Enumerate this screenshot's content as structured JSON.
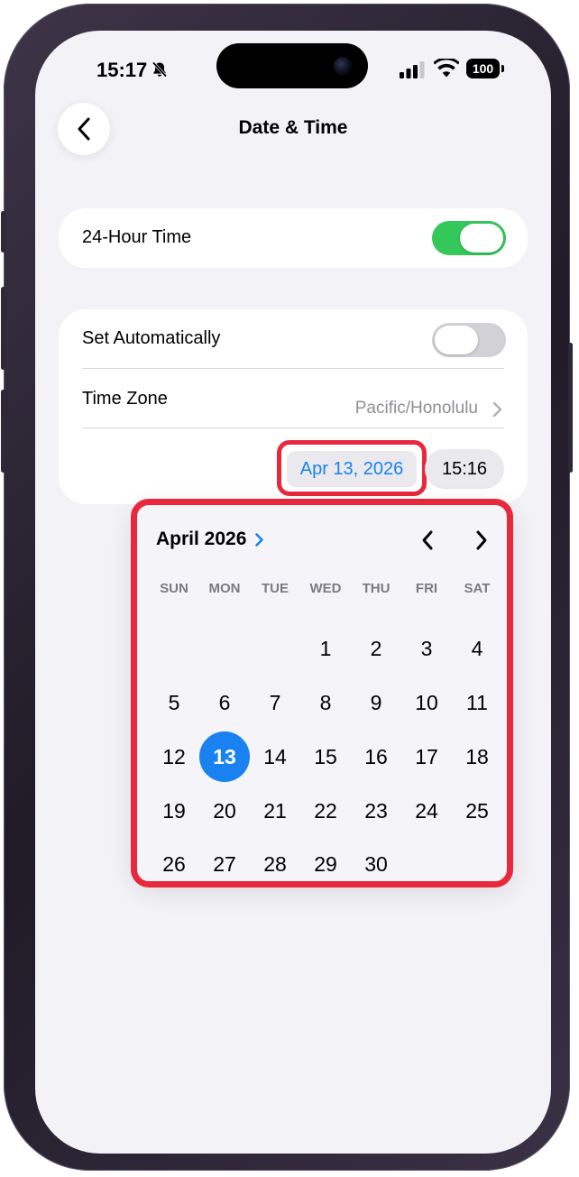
{
  "status_bar": {
    "time": "15:17",
    "battery": "100"
  },
  "nav": {
    "title": "Date & Time"
  },
  "settings": {
    "hour24_label": "24-Hour Time",
    "hour24_on": true,
    "set_auto_label": "Set Automatically",
    "set_auto_on": false,
    "time_zone_label": "Time Zone",
    "time_zone_value": "Pacific/Honolulu",
    "date_value": "Apr 13, 2026",
    "time_value": "15:16"
  },
  "calendar": {
    "month_label": "April 2026",
    "weekdays": [
      "SUN",
      "MON",
      "TUE",
      "WED",
      "THU",
      "FRI",
      "SAT"
    ],
    "first_weekday_index": 3,
    "days": [
      "1",
      "2",
      "3",
      "4",
      "5",
      "6",
      "7",
      "8",
      "9",
      "10",
      "11",
      "12",
      "13",
      "14",
      "15",
      "16",
      "17",
      "18",
      "19",
      "20",
      "21",
      "22",
      "23",
      "24",
      "25",
      "26",
      "27",
      "28",
      "29",
      "30"
    ],
    "selected_day": "13"
  },
  "colors": {
    "accent": "#1a82f0",
    "toggle_on": "#34c759",
    "toggle_off": "#d1d1d6",
    "highlight": "#e8283c"
  },
  "icons": {
    "bell": "bell-slash-icon",
    "signal": "cellular-signal-icon",
    "wifi": "wifi-icon",
    "back": "chevron-left-icon",
    "tz_chevron": "chevron-right-icon",
    "month_chevron": "chevron-right-icon",
    "prev": "chevron-left-icon",
    "next": "chevron-right-icon"
  }
}
